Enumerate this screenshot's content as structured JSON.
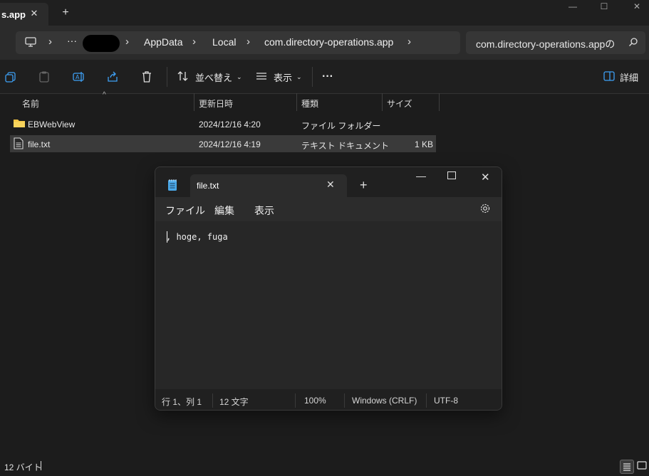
{
  "window": {
    "tab_title": "s.app"
  },
  "address": {
    "ellipsis": "···",
    "crumbs": [
      "AppData",
      "Local",
      "com.directory-operations.app"
    ]
  },
  "search": {
    "value": "com.directory-operations.appの"
  },
  "commandbar": {
    "sort_label": "並べ替え",
    "view_label": "表示",
    "more_label": "···",
    "details_label": "詳細"
  },
  "columns": {
    "name": "名前",
    "modified": "更新日時",
    "type": "種類",
    "size": "サイズ"
  },
  "files": [
    {
      "name": "EBWebView",
      "modified": "2024/12/16 4:20",
      "type": "ファイル フォルダー",
      "size": ""
    },
    {
      "name": "file.txt",
      "modified": "2024/12/16 4:19",
      "type": "テキスト ドキュメント",
      "size": "1 KB"
    }
  ],
  "statusbar": {
    "text": "12 バイト"
  },
  "notepad": {
    "tab_title": "file.txt",
    "menu": [
      "ファイル",
      "編集",
      "表示"
    ],
    "content": ", hoge, fuga",
    "status": {
      "position": "行 1、列 1",
      "chars": "12 文字",
      "zoom": "100%",
      "line_ending": "Windows (CRLF)",
      "encoding": "UTF-8"
    }
  },
  "colors": {
    "accent_folder": "#f4c542",
    "background": "#1c1c1c"
  }
}
